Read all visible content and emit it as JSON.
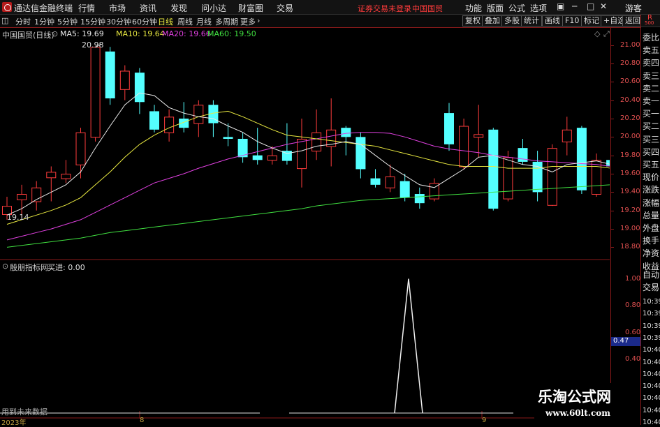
{
  "app": {
    "title": "通达信金融终端",
    "menus": [
      "行情",
      "市场",
      "资讯",
      "发现",
      "问小达",
      "财富圈",
      "交易"
    ],
    "notice": "证券交易未登录",
    "notice_stock": "中国国贸",
    "right_menus": [
      "功能",
      "版面",
      "公式",
      "选项"
    ],
    "guest": "游客",
    "r_badge": "R",
    "r_badge_sub": "500"
  },
  "toolbar": {
    "periods": [
      "分时",
      "1分钟",
      "5分钟",
      "15分钟",
      "30分钟",
      "60分钟",
      "日线",
      "周线",
      "月线",
      "多周期",
      "更多"
    ],
    "active_period": "日线",
    "right_buttons": [
      "复权",
      "叠加",
      "多股",
      "统计",
      "画线",
      "F10",
      "标记",
      "+自选",
      "返回"
    ]
  },
  "main_chart": {
    "stock_label": "中国国贸(日线)",
    "ma": [
      {
        "label": "MA5: 19.69",
        "color": "#e8e8e8"
      },
      {
        "label": "MA10: 19.64",
        "color": "#e8e840"
      },
      {
        "label": "MA20: 19.66",
        "color": "#e040e0"
      },
      {
        "label": "MA60: 19.50",
        "color": "#40e040"
      }
    ],
    "high_marker": "20.98",
    "low_marker": "19.14",
    "y_ticks": [
      "21.00",
      "20.80",
      "20.60",
      "20.40",
      "20.20",
      "20.00",
      "19.80",
      "19.60",
      "19.40",
      "19.20",
      "19.00",
      "18.80"
    ],
    "y_range": [
      18.75,
      21.05
    ]
  },
  "chart_data": {
    "type": "candlestick",
    "ohlc": [
      [
        19.16,
        19.25,
        19.35,
        19.1
      ],
      [
        19.32,
        19.38,
        19.48,
        19.12
      ],
      [
        19.3,
        19.45,
        19.52,
        19.2
      ],
      [
        19.56,
        19.62,
        19.68,
        19.3
      ],
      [
        19.55,
        19.6,
        19.75,
        19.5
      ],
      [
        19.7,
        20.05,
        20.1,
        19.55
      ],
      [
        20.0,
        20.98,
        20.98,
        19.95
      ],
      [
        20.93,
        20.42,
        20.98,
        20.35
      ],
      [
        20.52,
        20.72,
        20.78,
        20.4
      ],
      [
        20.7,
        20.38,
        20.75,
        20.25
      ],
      [
        20.28,
        20.08,
        20.35,
        20.05
      ],
      [
        20.05,
        20.22,
        20.3,
        19.95
      ],
      [
        20.2,
        20.1,
        20.38,
        20.05
      ],
      [
        20.15,
        20.35,
        20.4,
        20.0
      ],
      [
        20.35,
        20.15,
        20.4,
        20.0
      ],
      [
        20.0,
        19.98,
        20.15,
        19.9
      ],
      [
        19.98,
        19.78,
        20.05,
        19.72
      ],
      [
        19.8,
        19.75,
        20.1,
        19.7
      ],
      [
        19.75,
        19.8,
        19.9,
        19.7
      ],
      [
        19.85,
        19.74,
        20.15,
        19.7
      ],
      [
        19.66,
        19.98,
        20.2,
        19.45
      ],
      [
        19.85,
        20.05,
        20.3,
        19.75
      ],
      [
        19.9,
        20.08,
        20.42,
        19.68
      ],
      [
        20.1,
        20.0,
        20.12,
        19.8
      ],
      [
        20.0,
        19.65,
        20.05,
        19.55
      ],
      [
        19.55,
        19.48,
        19.65,
        19.45
      ],
      [
        19.45,
        19.57,
        19.7,
        19.4
      ],
      [
        19.52,
        19.34,
        19.6,
        19.3
      ],
      [
        19.38,
        19.28,
        19.45,
        19.22
      ],
      [
        19.33,
        19.5,
        19.55,
        19.3
      ],
      [
        20.26,
        19.92,
        20.37,
        19.85
      ],
      [
        19.68,
        20.12,
        20.2,
        19.65
      ],
      [
        20.0,
        20.03,
        20.35,
        19.78
      ],
      [
        20.08,
        19.22,
        20.1,
        19.2
      ],
      [
        19.33,
        19.78,
        19.85,
        19.3
      ],
      [
        19.88,
        19.73,
        19.98,
        19.7
      ],
      [
        19.73,
        19.4,
        19.85,
        19.3
      ],
      [
        19.26,
        19.88,
        19.92,
        19.25
      ],
      [
        19.95,
        20.08,
        20.22,
        19.8
      ],
      [
        20.1,
        19.42,
        20.12,
        19.38
      ],
      [
        19.38,
        19.75,
        19.82,
        19.35
      ],
      [
        19.75,
        19.68,
        19.8,
        19.65
      ],
      [
        19.58,
        19.68,
        19.9,
        19.48
      ]
    ],
    "ma5": [
      19.15,
      19.22,
      19.32,
      19.4,
      19.48,
      19.62,
      19.88,
      20.12,
      20.35,
      20.48,
      20.45,
      20.32,
      20.26,
      20.22,
      20.2,
      20.12,
      20.05,
      19.95,
      19.88,
      19.82,
      19.85,
      19.9,
      19.92,
      19.95,
      19.92,
      19.8,
      19.68,
      19.58,
      19.48,
      19.45,
      19.55,
      19.65,
      19.78,
      19.8,
      19.75,
      19.7,
      19.68,
      19.62,
      19.7,
      19.72,
      19.74,
      19.7,
      19.69
    ],
    "ma10": [
      19.05,
      19.1,
      19.15,
      19.2,
      19.26,
      19.34,
      19.48,
      19.62,
      19.78,
      19.92,
      20.02,
      20.1,
      20.16,
      20.22,
      20.26,
      20.28,
      20.22,
      20.15,
      20.08,
      20.02,
      20.0,
      19.98,
      19.96,
      19.94,
      19.92,
      19.9,
      19.86,
      19.82,
      19.78,
      19.74,
      19.7,
      19.68,
      19.68,
      19.68,
      19.66,
      19.66,
      19.66,
      19.68,
      19.68,
      19.68,
      19.68,
      19.66,
      19.64
    ],
    "ma20": [
      18.88,
      18.92,
      18.96,
      19.0,
      19.05,
      19.1,
      19.18,
      19.26,
      19.34,
      19.42,
      19.5,
      19.55,
      19.6,
      19.66,
      19.71,
      19.76,
      19.8,
      19.84,
      19.88,
      19.92,
      19.95,
      19.98,
      20.01,
      20.04,
      20.05,
      20.05,
      20.04,
      20.0,
      19.95,
      19.9,
      19.87,
      19.85,
      19.83,
      19.8,
      19.78,
      19.76,
      19.74,
      19.73,
      19.72,
      19.71,
      19.7,
      19.68,
      19.66
    ],
    "ma60": [
      18.8,
      18.82,
      18.84,
      18.86,
      18.88,
      18.9,
      18.93,
      18.96,
      18.98,
      19.0,
      19.02,
      19.04,
      19.06,
      19.08,
      19.1,
      19.12,
      19.14,
      19.16,
      19.18,
      19.2,
      19.22,
      19.25,
      19.27,
      19.29,
      19.31,
      19.32,
      19.33,
      19.34,
      19.35,
      19.36,
      19.37,
      19.38,
      19.39,
      19.4,
      19.41,
      19.42,
      19.43,
      19.44,
      19.45,
      19.46,
      19.47,
      19.48,
      19.5
    ],
    "indicator": {
      "title": "殷朋指标网",
      "buy_label": "买进: 0.00",
      "y_ticks": [
        "1.00",
        "0.80",
        "0.60",
        "0.40",
        "0.20"
      ],
      "ylim": [
        0,
        1.05
      ],
      "current_value": "0.47",
      "spike_index": 28,
      "values": [
        0,
        0,
        0,
        0,
        0,
        0,
        0,
        0,
        0,
        0,
        0,
        0,
        0,
        0,
        0,
        0,
        0,
        0,
        0,
        0,
        0,
        0,
        0,
        0,
        0,
        0,
        0,
        0,
        1,
        0,
        0,
        0,
        0,
        0,
        0,
        0,
        0,
        0,
        0,
        0,
        0,
        0,
        0
      ]
    },
    "x_labels": [
      "2023年",
      "8",
      "9"
    ],
    "warning": "用到未来数据"
  },
  "right_panel": {
    "items": [
      "委比",
      "卖五",
      "卖四",
      "卖三",
      "卖二",
      "卖一",
      "买一",
      "买二",
      "买三",
      "买四",
      "买五",
      "现价",
      "涨跌",
      "涨幅",
      "总量",
      "外盘",
      "换手",
      "净资",
      "收益",
      "自动",
      "交易"
    ],
    "times": [
      "10:39",
      "10:39",
      "10:39",
      "10:39",
      "10:40",
      "10:40",
      "10:40",
      "10:40",
      "10:40",
      "10:40",
      "10:40"
    ]
  },
  "watermark": {
    "title": "乐淘公式网",
    "url": "www.60lt.com"
  }
}
